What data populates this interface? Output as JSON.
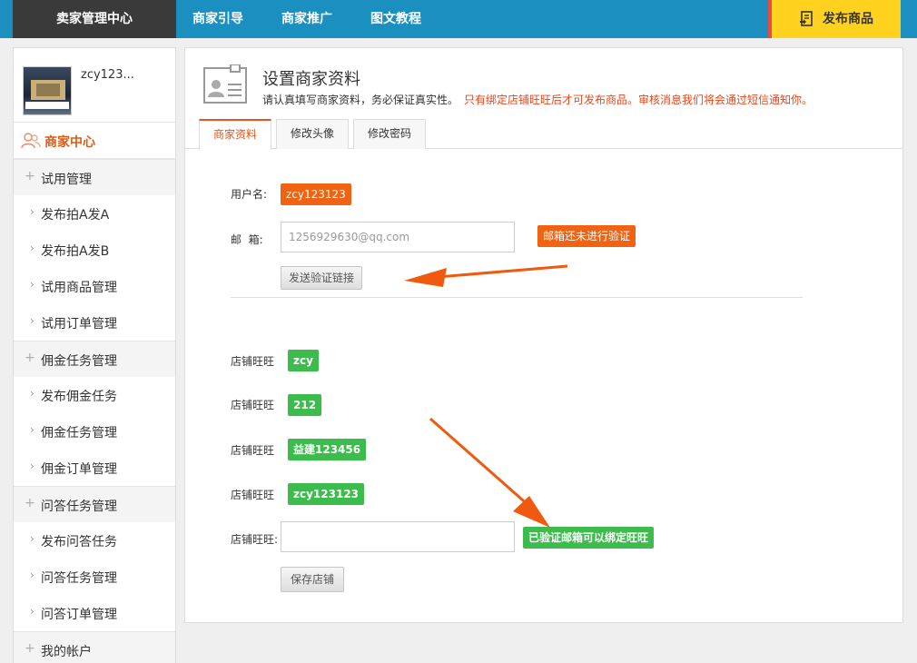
{
  "topbar": {
    "brand": "卖家管理中心",
    "nav": [
      "商家引导",
      "商家推广",
      "图文教程"
    ],
    "publish_label": "发布商品"
  },
  "sidebar": {
    "username": "zcy123...",
    "home_label": "商家中心",
    "groups": [
      {
        "label": "试用管理",
        "items": [
          "发布拍A发A",
          "发布拍A发B",
          "试用商品管理",
          "试用订单管理"
        ]
      },
      {
        "label": "佣金任务管理",
        "items": [
          "发布佣金任务",
          "佣金任务管理",
          "佣金订单管理"
        ]
      },
      {
        "label": "问答任务管理",
        "items": [
          "发布问答任务",
          "问答任务管理",
          "问答订单管理"
        ]
      },
      {
        "label": "我的帐户",
        "items": []
      }
    ]
  },
  "main": {
    "title": "设置商家资料",
    "subtitle": "请认真填写商家资料，务必保证真实性。",
    "warning": "只有绑定店铺旺旺后才可发布商品。审核消息我们将会通过短信通知你。",
    "tabs": [
      "商家资料",
      "修改头像",
      "修改密码"
    ],
    "username_label": "用户名:",
    "username_value": "zcy123123",
    "email_label": "邮  箱:",
    "email_value": "1256929630@qq.com",
    "email_status": "邮箱还未进行验证",
    "send_verify_button": "发送验证链接",
    "shop_label": "店铺旺旺",
    "shops": [
      "zcy",
      "212",
      "益建123456",
      "zcy123123"
    ],
    "new_shop_label": "店铺旺旺:",
    "new_shop_value": "",
    "bind_hint": "已验证邮箱可以绑定旺旺",
    "save_button": "保存店铺"
  },
  "colors": {
    "topbar": "#1a8fc0",
    "brand_bg": "#3a3a3a",
    "publish_bg": "#ffd21f",
    "accent_orange": "#f06312",
    "accent_green": "#3dbc4e",
    "arrow": "#f05a10"
  }
}
